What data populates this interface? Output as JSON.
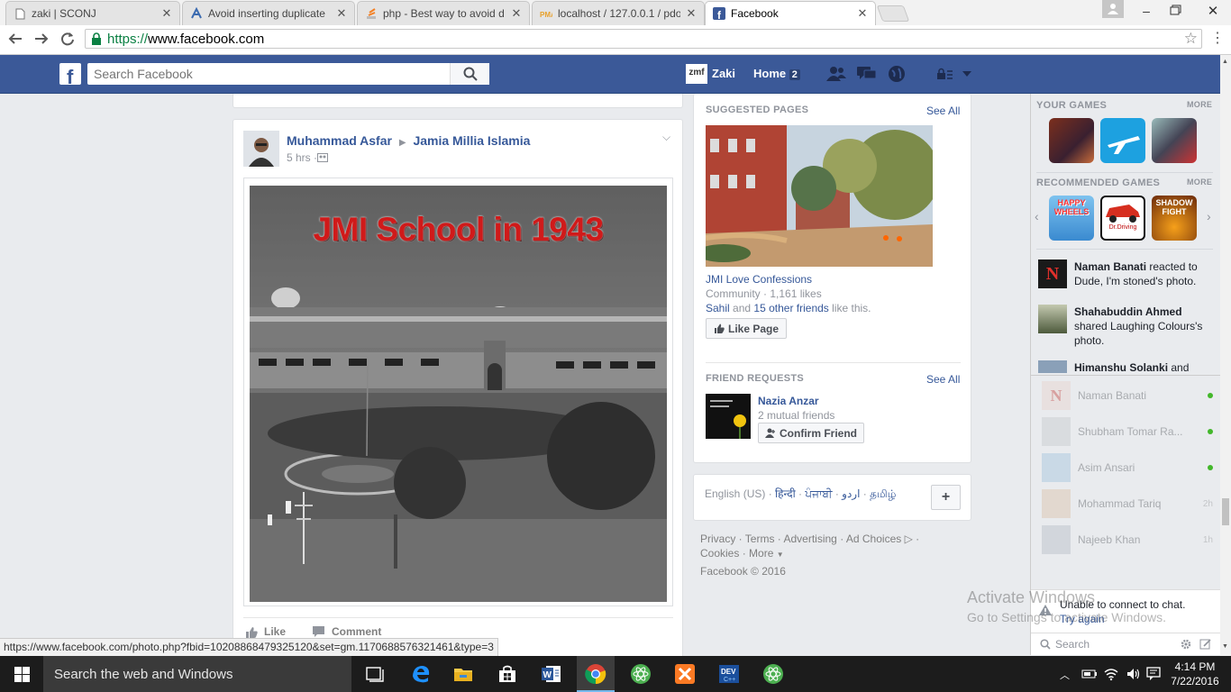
{
  "browser": {
    "tabs": [
      {
        "label": "zaki | SCONJ",
        "icon": "page-icon",
        "active": false
      },
      {
        "label": "Avoid inserting duplicate",
        "icon": "stackoverflow-icon",
        "active": false
      },
      {
        "label": "php - Best way to avoid d",
        "icon": "stackoverflow-icon",
        "active": false
      },
      {
        "label": "localhost / 127.0.0.1 / pdo",
        "icon": "phpmyadmin-icon",
        "active": false
      },
      {
        "label": "Facebook",
        "icon": "facebook-icon",
        "active": true
      }
    ],
    "url_scheme": "https://",
    "url_host": "www.facebook.com",
    "status_url": "https://www.facebook.com/photo.php?fbid=10208868479325120&set=gm.1170688576321461&type=3"
  },
  "fb": {
    "search_placeholder": "Search Facebook",
    "user_name": "Zaki",
    "user_avatar_text": "zmf",
    "home_label": "Home",
    "home_count": "2",
    "brand_color": "#3b5998"
  },
  "post": {
    "author": "Muhammad Asfar",
    "group": "Jamia Millia Islamia",
    "time": "5 hrs · ",
    "photo_caption": "JMI School in 1943",
    "like_label": "Like",
    "comment_label": "Comment"
  },
  "suggested": {
    "title": "SUGGESTED PAGES",
    "see_all": "See All",
    "page_name": "JMI Love Confessions",
    "page_meta": "Community · 1,161 likes",
    "friend": "Sahil",
    "and": "and",
    "others": "15 other friends",
    "like_this": "like this.",
    "like_page": "Like Page"
  },
  "requests": {
    "title": "FRIEND REQUESTS",
    "see_all": "See All",
    "name": "Nazia Anzar",
    "mutual": "2 mutual friends",
    "confirm": "Confirm Friend"
  },
  "languages": {
    "current": "English (US) · ",
    "items": [
      "हिन्दी",
      "ਪੰਜਾਬੀ",
      "اردو",
      "தமிழ்"
    ],
    "sep": " · ",
    "add": "+"
  },
  "footer": {
    "links_line1": [
      "Privacy",
      "Terms",
      "Advertising",
      "Ad Choices"
    ],
    "links_line2_a": "Cookies",
    "links_line2_b": "More",
    "copyright": "Facebook © 2016"
  },
  "sidebar": {
    "your_games": "YOUR GAMES",
    "more": "MORE",
    "recommended_games": "RECOMMENDED GAMES",
    "game_label_1": "HAPPY WHEELS",
    "game_label_2": "Dr.Driving",
    "game_label_3": "SHADOW FIGHT",
    "ticker": [
      {
        "name": "Naman Banati",
        "text": " reacted to Dude, I'm stoned's photo."
      },
      {
        "name": "Shahabuddin Ahmed",
        "text": " shared Laughing Colours's photo."
      },
      {
        "name": "Himanshu Solanki",
        "text": " and"
      }
    ],
    "contacts": [
      {
        "name": "Naman Banati",
        "status": ""
      },
      {
        "name": "Shubham Tomar Ra...",
        "status": ""
      },
      {
        "name": "Asim Ansari",
        "status": ""
      },
      {
        "name": "Mohammad Tariq",
        "status": "2h"
      },
      {
        "name": "Najeeb Khan",
        "status": "1h"
      }
    ],
    "chat_error": "Unable to connect to chat.",
    "try_again": "Try again",
    "search": "Search"
  },
  "watermark": {
    "line1": "Activate Windows",
    "line2": "Go to Settings to activate Windows."
  },
  "taskbar": {
    "search": "Search the web and Windows",
    "time": "4:14 PM",
    "date": "7/22/2016"
  }
}
